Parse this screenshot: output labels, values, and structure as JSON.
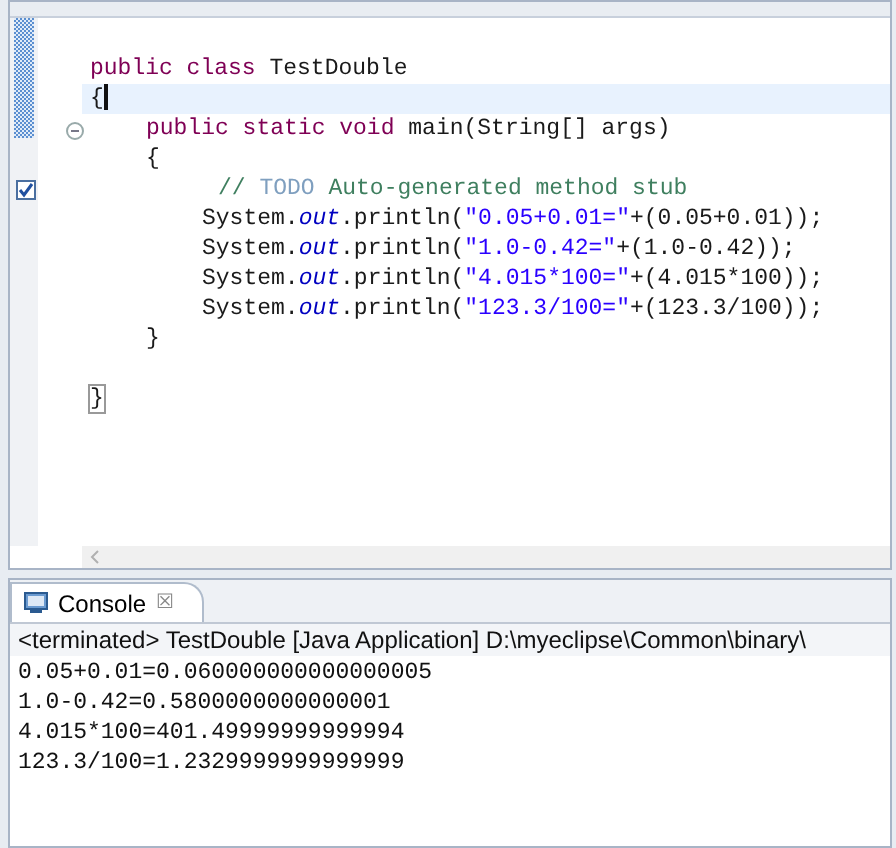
{
  "editor": {
    "lines": [
      {
        "segments": [
          {
            "kind": "keyword",
            "text": "public class"
          },
          {
            "kind": "plain",
            "text": " TestDouble"
          }
        ]
      },
      {
        "segments": [
          {
            "kind": "plain",
            "text": "{"
          }
        ],
        "current": true,
        "children": [
          {
            "segments": [
              {
                "kind": "keyword",
                "text": "public static void"
              },
              {
                "kind": "plain",
                "text": " main(String[] args)"
              }
            ],
            "foldable": true
          },
          {
            "segments": [
              {
                "kind": "plain",
                "text": "{"
              }
            ],
            "children": [
              {
                "segments": [
                  {
                    "kind": "comment",
                    "text": "// "
                  },
                  {
                    "kind": "todo",
                    "text": "TODO"
                  },
                  {
                    "kind": "comment",
                    "text": " Auto-generated method stub"
                  }
                ],
                "task": true
              },
              {
                "segments": [
                  {
                    "kind": "plain",
                    "text": "System."
                  },
                  {
                    "kind": "field",
                    "text": "out"
                  },
                  {
                    "kind": "plain",
                    "text": ".println("
                  },
                  {
                    "kind": "string",
                    "text": "\"0.05+0.01=\""
                  },
                  {
                    "kind": "plain",
                    "text": "+(0.05+0.01));"
                  }
                ]
              },
              {
                "segments": [
                  {
                    "kind": "plain",
                    "text": "System."
                  },
                  {
                    "kind": "field",
                    "text": "out"
                  },
                  {
                    "kind": "plain",
                    "text": ".println("
                  },
                  {
                    "kind": "string",
                    "text": "\"1.0-0.42=\""
                  },
                  {
                    "kind": "plain",
                    "text": "+(1.0-0.42));"
                  }
                ]
              },
              {
                "segments": [
                  {
                    "kind": "plain",
                    "text": "System."
                  },
                  {
                    "kind": "field",
                    "text": "out"
                  },
                  {
                    "kind": "plain",
                    "text": ".println("
                  },
                  {
                    "kind": "string",
                    "text": "\"4.015*100=\""
                  },
                  {
                    "kind": "plain",
                    "text": "+(4.015*100));"
                  }
                ]
              },
              {
                "segments": [
                  {
                    "kind": "plain",
                    "text": "System."
                  },
                  {
                    "kind": "field",
                    "text": "out"
                  },
                  {
                    "kind": "plain",
                    "text": ".println("
                  },
                  {
                    "kind": "string",
                    "text": "\"123.3/100=\""
                  },
                  {
                    "kind": "plain",
                    "text": "+(123.3/100));"
                  }
                ]
              }
            ]
          },
          {
            "segments": [
              {
                "kind": "plain",
                "text": "}"
              }
            ]
          }
        ]
      },
      {
        "segments": [
          {
            "kind": "bracket",
            "text": "}"
          }
        ],
        "spaced": true
      }
    ]
  },
  "console": {
    "tab": {
      "label": "Console",
      "close": "☒",
      "selected": true
    },
    "status": "<terminated> TestDouble [Java Application] D:\\myeclipse\\Common\\binary\\",
    "output": [
      "0.05+0.01=0.060000000000000005",
      "1.0-0.42=0.5800000000000001",
      "4.015*100=401.49999999999994",
      "123.3/100=1.2329999999999999"
    ]
  }
}
